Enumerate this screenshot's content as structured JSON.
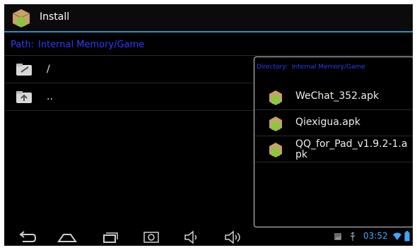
{
  "titlebar": {
    "title": "Install"
  },
  "pathbar": {
    "label": "Path:",
    "value": "Internal Memory/Game"
  },
  "file_list": [
    {
      "name": "/",
      "icon": "folder-back-icon"
    },
    {
      "name": "..",
      "icon": "folder-up-icon"
    }
  ],
  "panel": {
    "directory_label": "Directory:",
    "directory_value": "Internal Memory/Game",
    "apks": [
      {
        "name": "WeChat_352.apk",
        "icon": "android-package-icon"
      },
      {
        "name": "Qiexigua.apk",
        "icon": "android-package-icon"
      },
      {
        "name": "QQ_for_Pad_v1.9.2-1.apk",
        "icon": "android-package-icon"
      }
    ]
  },
  "status_bar": {
    "time": "03:52"
  },
  "colors": {
    "accent": "#2a8fc4",
    "path_text": "#2f3cff",
    "clock": "#3fa9ff"
  }
}
